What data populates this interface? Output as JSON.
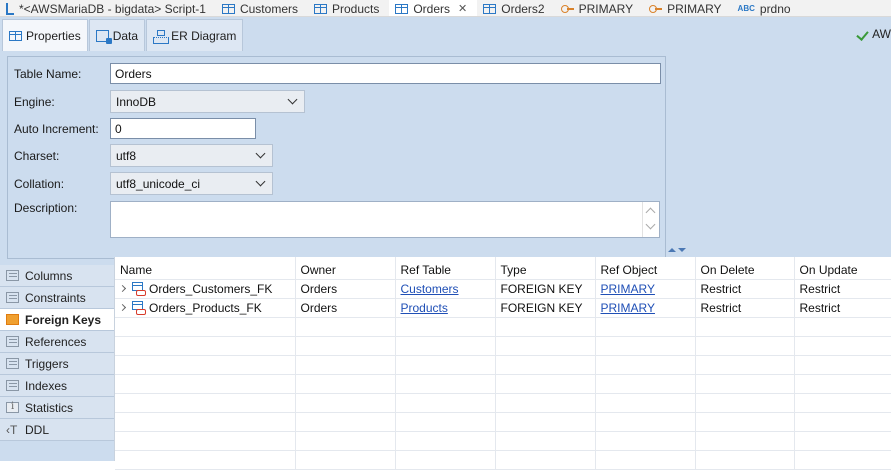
{
  "editor_tabs": [
    {
      "label": "*<AWSMariaDB - bigdata> Script-1",
      "icon": "script-icon",
      "active": false
    },
    {
      "label": "Customers",
      "icon": "table-icon",
      "active": false
    },
    {
      "label": "Products",
      "icon": "table-icon",
      "active": false
    },
    {
      "label": "Orders",
      "icon": "table-icon",
      "active": true,
      "close": "✕"
    },
    {
      "label": "Orders2",
      "icon": "table-icon",
      "active": false
    },
    {
      "label": "PRIMARY",
      "icon": "key-icon",
      "active": false
    },
    {
      "label": "PRIMARY",
      "icon": "key-icon",
      "active": false
    },
    {
      "label": "prdno",
      "icon": "abc-column-icon",
      "active": false
    }
  ],
  "subtabs": [
    {
      "label": "Properties",
      "active": true
    },
    {
      "label": "Data",
      "active": false
    },
    {
      "label": "ER Diagram",
      "active": false
    }
  ],
  "right_link": "AW",
  "form": {
    "table_name": {
      "label": "Table Name:",
      "value": "Orders"
    },
    "engine": {
      "label": "Engine:",
      "value": "InnoDB"
    },
    "auto_increment": {
      "label": "Auto Increment:",
      "value": "0"
    },
    "charset": {
      "label": "Charset:",
      "value": "utf8"
    },
    "collation": {
      "label": "Collation:",
      "value": "utf8_unicode_ci"
    },
    "description": {
      "label": "Description:",
      "value": ""
    }
  },
  "side_tabs": [
    {
      "label": "Columns",
      "active": false
    },
    {
      "label": "Constraints",
      "active": false
    },
    {
      "label": "Foreign Keys",
      "active": true
    },
    {
      "label": "References",
      "active": false
    },
    {
      "label": "Triggers",
      "active": false
    },
    {
      "label": "Indexes",
      "active": false
    },
    {
      "label": "Statistics",
      "active": false
    },
    {
      "label": "DDL",
      "active": false
    }
  ],
  "fk_table": {
    "columns": [
      "Name",
      "Owner",
      "Ref Table",
      "Type",
      "Ref Object",
      "On Delete",
      "On Update"
    ],
    "rows": [
      {
        "name": "Orders_Customers_FK",
        "owner": "Orders",
        "ref_table": "Customers",
        "type": "FOREIGN KEY",
        "ref_object": "PRIMARY",
        "on_delete": "Restrict",
        "on_update": "Restrict"
      },
      {
        "name": "Orders_Products_FK",
        "owner": "Orders",
        "ref_table": "Products",
        "type": "FOREIGN KEY",
        "ref_object": "PRIMARY",
        "on_delete": "Restrict",
        "on_update": "Restrict"
      }
    ]
  },
  "colors": {
    "accent": "#2b78c5",
    "panel_bg": "#ccdcee",
    "link": "#1f4fb6"
  }
}
